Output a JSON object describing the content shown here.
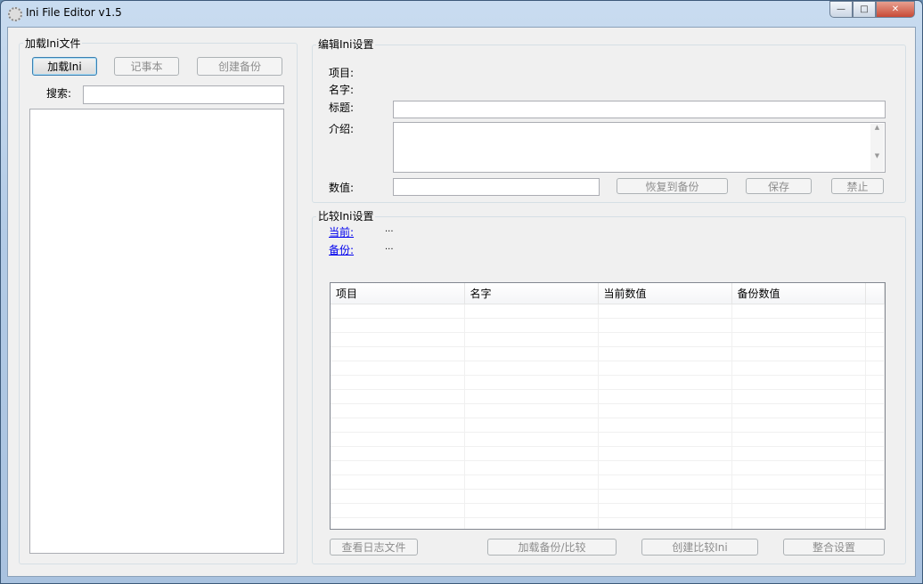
{
  "window": {
    "title": "Ini File Editor v1.5",
    "minimize": "—",
    "maximize": "□",
    "close": "✕"
  },
  "load_group": {
    "title": "加载Ini文件",
    "load_button": "加载Ini",
    "notepad_button": "记事本",
    "backup_button": "创建备份",
    "search_label": "搜索:",
    "search_value": ""
  },
  "edit_group": {
    "title": "编辑Ini设置",
    "item_label": "项目:",
    "name_label": "名字:",
    "caption_label": "标题:",
    "desc_label": "介绍:",
    "value_label": "数值:",
    "restore_button": "恢复到备份",
    "save_button": "保存",
    "disable_button": "禁止"
  },
  "compare_group": {
    "title": "比较Ini设置",
    "current_link": "当前:",
    "current_value": "...",
    "backup_link": "备份:",
    "backup_value": "...",
    "columns": [
      "项目",
      "名字",
      "当前数值",
      "备份数值"
    ],
    "log_button": "查看日志文件",
    "load_backup_button": "加载备份/比较",
    "create_compare_button": "创建比较Ini",
    "merge_button": "整合设置"
  }
}
